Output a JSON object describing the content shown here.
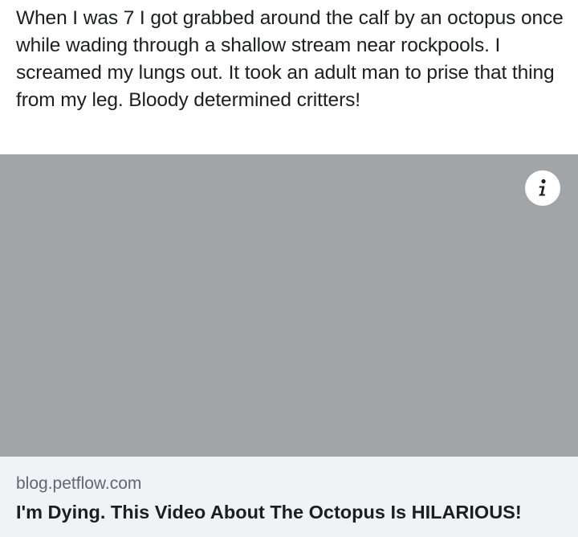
{
  "post": {
    "text": "When I was 7 I got grabbed around the calf by an octopus once while wading through a shallow stream near rockpools.  I screamed my lungs out.  It took an adult man to prise that thing from my leg.  Bloody determined critters!"
  },
  "link_card": {
    "info_icon": "info-icon",
    "domain": "blog.petflow.com",
    "title": "I'm Dying. This Video About The Octopus Is HILARIOUS!"
  },
  "colors": {
    "text": "#1c1e21",
    "secondary_text": "#606770",
    "image_placeholder": "#a2a5a8",
    "footer_background": "#f0f2f5"
  }
}
